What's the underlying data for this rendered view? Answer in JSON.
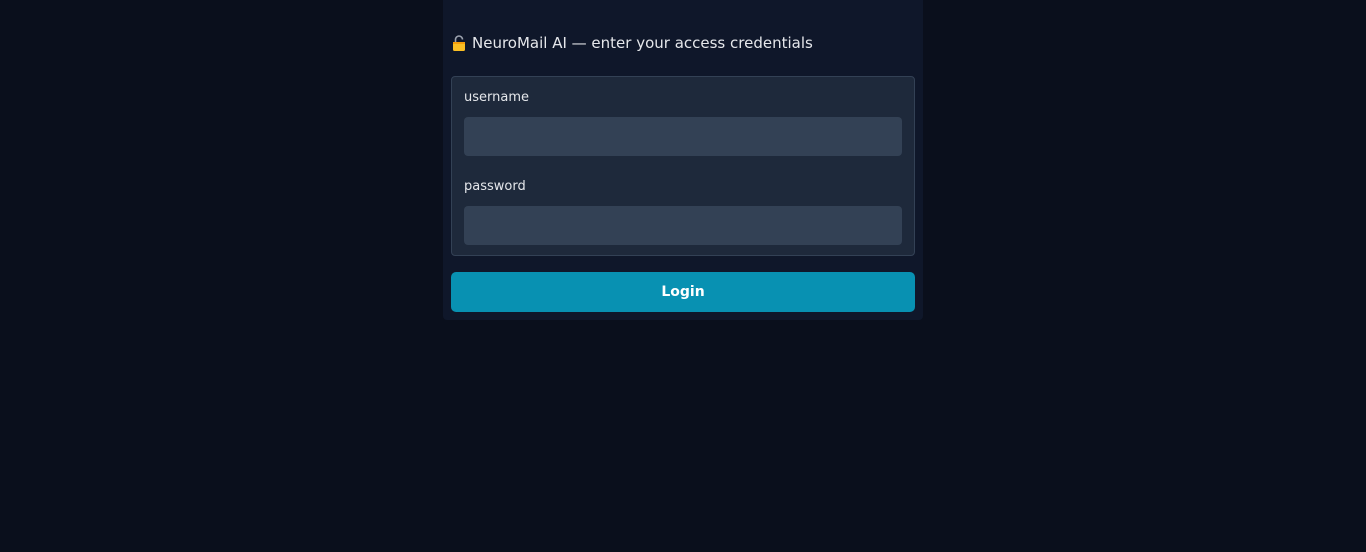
{
  "login": {
    "heading_icon": "lock-icon",
    "heading": "NeuroMail AI — enter your access credentials",
    "username_label": "username",
    "username_value": "",
    "password_label": "password",
    "password_value": "",
    "button_label": "Login"
  },
  "colors": {
    "page_background": "#0a0f1c",
    "panel_background": "#0f172a",
    "form_background": "#1e293b",
    "input_background": "#334155",
    "accent": "#0891b2",
    "lock_icon": "#fbbf24"
  }
}
